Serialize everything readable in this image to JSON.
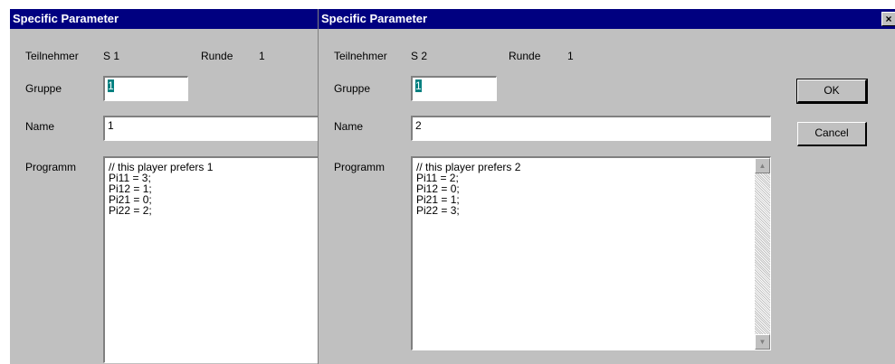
{
  "dialogs": [
    {
      "title": "Specific Parameter",
      "teilnehmer_label": "Teilnehmer",
      "teilnehmer_value": "S 1",
      "runde_label": "Runde",
      "runde_value": "1",
      "gruppe_label": "Gruppe",
      "gruppe_value": "1",
      "name_label": "Name",
      "name_value": "1",
      "programm_label": "Programm",
      "programm_lines": [
        "// this player prefers 1",
        "Pi11 = 3;",
        "Pi12 = 1;",
        "Pi21 = 0;",
        "Pi22 = 2;"
      ]
    },
    {
      "title": "Specific Parameter",
      "teilnehmer_label": "Teilnehmer",
      "teilnehmer_value": "S 2",
      "runde_label": "Runde",
      "runde_value": "1",
      "gruppe_label": "Gruppe",
      "gruppe_value": "1",
      "name_label": "Name",
      "name_value": "2",
      "programm_label": "Programm",
      "programm_lines": [
        "// this player prefers 2",
        "Pi11 = 2;",
        "Pi12 = 0;",
        "Pi21 = 1;",
        "Pi22 = 3;"
      ],
      "close_label": "×",
      "ok_label": "OK",
      "cancel_label": "Cancel"
    }
  ],
  "colors": {
    "titlebar": "#000080",
    "face": "#c0c0c0",
    "selection": "#008080"
  },
  "icons": {
    "close": "close-icon",
    "scroll_up": "scroll-up-arrow-icon",
    "scroll_down": "scroll-down-arrow-icon"
  }
}
